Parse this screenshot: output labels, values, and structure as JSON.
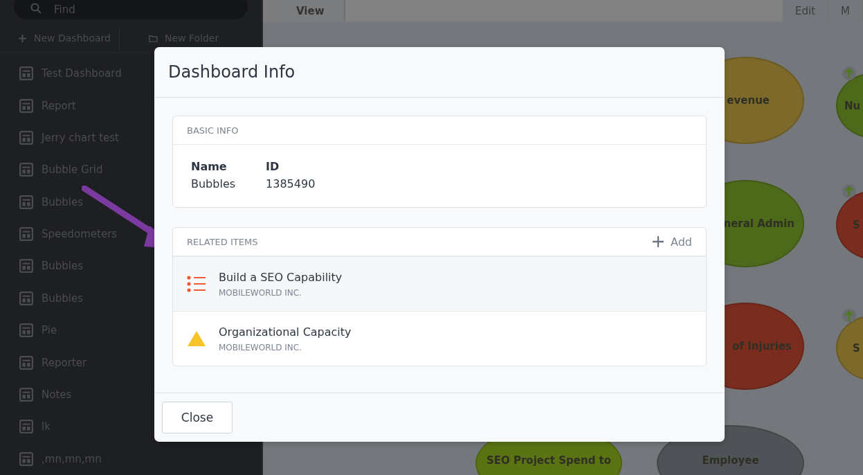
{
  "sidebar": {
    "search": {
      "placeholder": "Find"
    },
    "toolbar": [
      {
        "kind": "plus",
        "label": "New Dashboard"
      },
      {
        "kind": "folder",
        "label": "New Folder"
      }
    ],
    "items": [
      "Test Dashboard",
      "Report",
      "Jerry chart test",
      "Bubble Grid",
      "Bubbles",
      "Speedometers",
      "Bubbles",
      "Bubbles",
      "Pie",
      "Reporter",
      "Notes",
      "lk",
      ",mn,mn,mn"
    ]
  },
  "tabs": [
    {
      "label": "View",
      "selected": true
    },
    {
      "label": "Edit",
      "selected": false
    },
    {
      "label": "M",
      "selected": false
    }
  ],
  "bubbles": [
    {
      "label": "evenue",
      "color": "#7d6a2a"
    },
    {
      "label": "Nu",
      "color": "#4d6a1a",
      "up_arrow": true
    },
    {
      "label": "neral Admin",
      "color": "#4d6a1a"
    },
    {
      "label": "S",
      "color": "#7a2d1e",
      "up_arrow": true
    },
    {
      "label": "of Injuries",
      "color": "#7a2d1e"
    },
    {
      "label": "S",
      "color": "#7d6a2a",
      "up_arrow": true
    },
    {
      "label": "SEO Project Spend to",
      "color": "#5a7414"
    },
    {
      "label": "Employee",
      "color": "#4f5256"
    }
  ],
  "dialog": {
    "title": "Dashboard Info",
    "basic_info": {
      "heading": "BASIC INFO",
      "fields": [
        {
          "label": "Name",
          "value": "Bubbles"
        },
        {
          "label": "ID",
          "value": "1385490"
        }
      ]
    },
    "related_items": {
      "heading": "RELATED ITEMS",
      "add": "Add",
      "items": [
        {
          "kind": "list",
          "title": "Build a SEO Capability",
          "subtitle": "MOBILEWORLD INC."
        },
        {
          "kind": "warning",
          "title": "Organizational Capacity",
          "subtitle": "MOBILEWORLD INC."
        }
      ]
    },
    "close": "Close"
  }
}
